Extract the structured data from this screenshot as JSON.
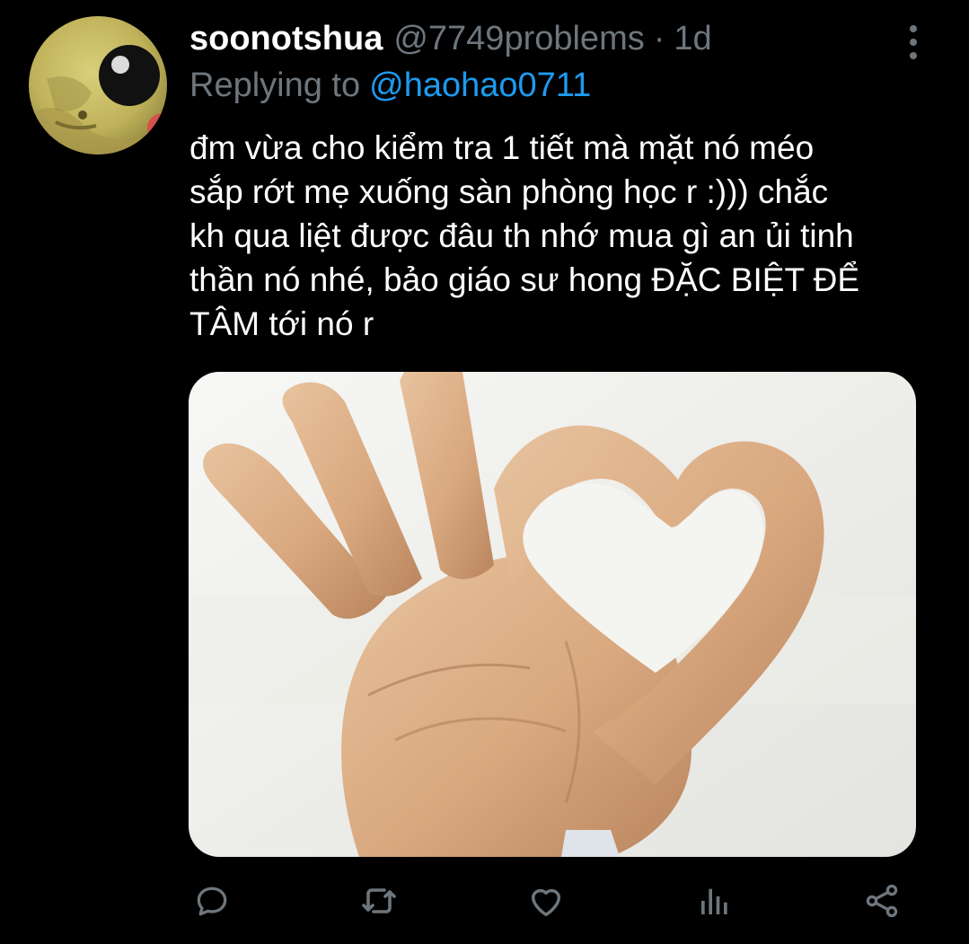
{
  "tweet": {
    "display_name": "soonotshua",
    "handle": "@7749problems",
    "separator": "·",
    "time": "1d",
    "reply_prefix": "Replying to",
    "reply_handle": "@haohao0711",
    "text_lines": [
      "đm vừa cho kiểm tra 1 tiết mà mặt nó méo",
      "sắp rớt mẹ xuống sàn phòng học r :))) chắc",
      "kh qua liệt được đâu th nhớ mua gì an ủi tinh",
      "thần nó nhé, bảo giáo sư hong ĐẶC BIỆT ĐỂ",
      "TÂM tới nó r"
    ]
  },
  "icons": {
    "more": "vertical-dots-icon",
    "reply": "speech-bubble-icon",
    "retweet": "retweet-icon",
    "like": "heart-icon",
    "analytics": "bar-chart-icon",
    "share": "share-icon"
  },
  "colors": {
    "background": "#000000",
    "primary_text": "#ffffff",
    "secondary_text": "#6e767d",
    "link": "#1d9bf0"
  }
}
